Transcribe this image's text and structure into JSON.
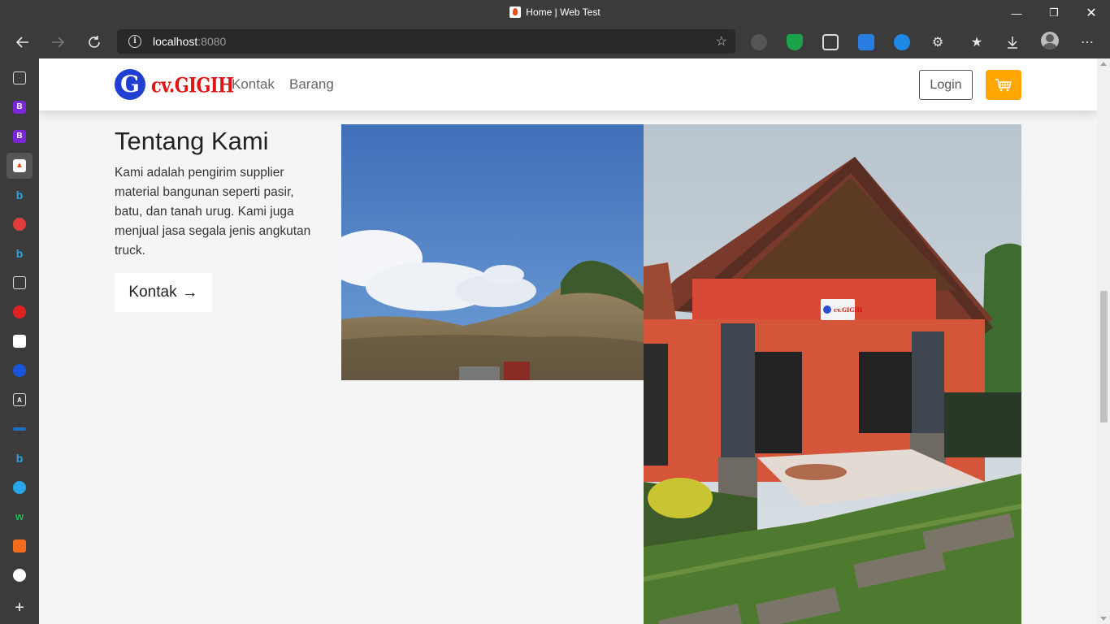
{
  "browser": {
    "window_title": "Home | Web Test",
    "url_host": "localhost",
    "url_port": ":8080"
  },
  "navbar": {
    "brand_letter": "G",
    "brand_name": "cv.GIGIH",
    "links": [
      "Kontak",
      "Barang"
    ],
    "login_label": "Login"
  },
  "about": {
    "heading": "Tentang Kami",
    "text": "Kami adalah pengirim supplier material bangunan seperti pasir, batu, dan tanah urug. Kami juga menjual jasa segala jenis angkutan truck.",
    "button_label": "Kontak",
    "button_arrow": "→"
  },
  "house_sign": "cv.GIGIH",
  "colors": {
    "cart_button": "#ffa600",
    "brand_red": "#e01414",
    "brand_blue": "#1e3fd0"
  }
}
